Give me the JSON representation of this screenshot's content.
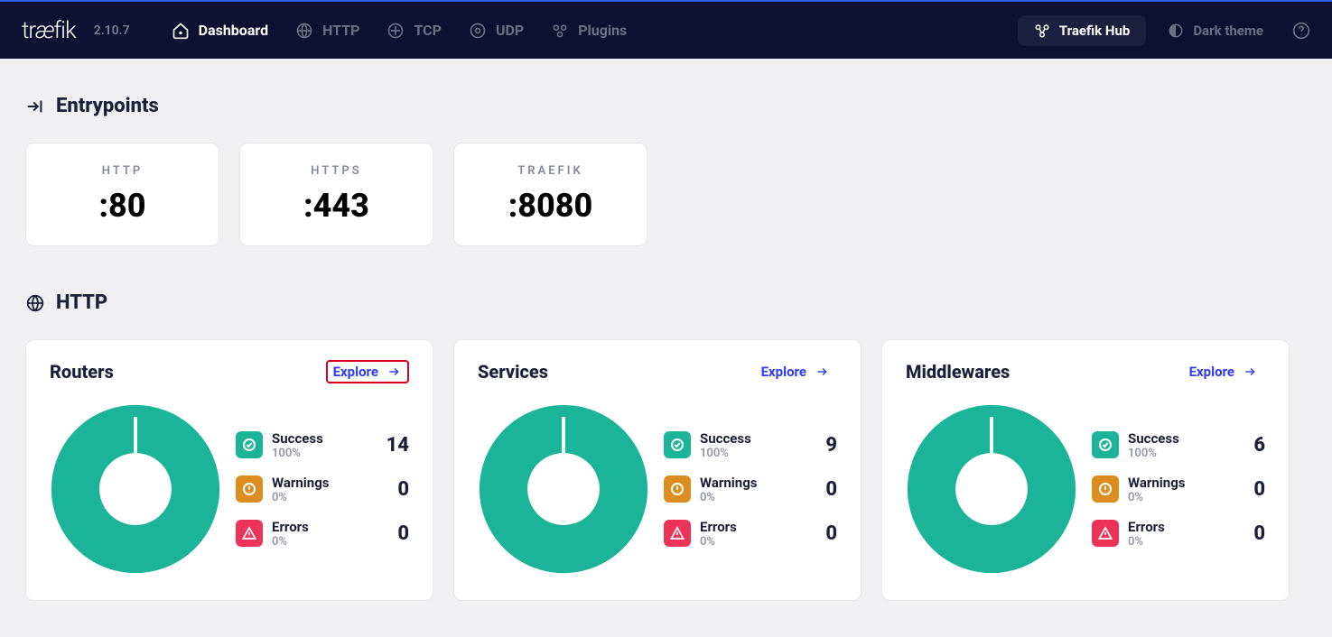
{
  "header": {
    "logo": "træfik",
    "version": "2.10.7",
    "nav": {
      "dashboard": "Dashboard",
      "http": "HTTP",
      "tcp": "TCP",
      "udp": "UDP",
      "plugins": "Plugins"
    },
    "hub": "Traefik Hub",
    "dark_theme": "Dark theme"
  },
  "sections": {
    "entrypoints": {
      "title": "Entrypoints"
    },
    "http": {
      "title": "HTTP"
    }
  },
  "entrypoints": [
    {
      "name": "HTTP",
      "port": ":80"
    },
    {
      "name": "HTTPS",
      "port": ":443"
    },
    {
      "name": "TRAEFIK",
      "port": ":8080"
    }
  ],
  "panels": {
    "routers": {
      "title": "Routers",
      "explore": "Explore",
      "success": {
        "label": "Success",
        "pct": "100%",
        "count": "14"
      },
      "warnings": {
        "label": "Warnings",
        "pct": "0%",
        "count": "0"
      },
      "errors": {
        "label": "Errors",
        "pct": "0%",
        "count": "0"
      }
    },
    "services": {
      "title": "Services",
      "explore": "Explore",
      "success": {
        "label": "Success",
        "pct": "100%",
        "count": "9"
      },
      "warnings": {
        "label": "Warnings",
        "pct": "0%",
        "count": "0"
      },
      "errors": {
        "label": "Errors",
        "pct": "0%",
        "count": "0"
      }
    },
    "middlewares": {
      "title": "Middlewares",
      "explore": "Explore",
      "success": {
        "label": "Success",
        "pct": "100%",
        "count": "6"
      },
      "warnings": {
        "label": "Warnings",
        "pct": "0%",
        "count": "0"
      },
      "errors": {
        "label": "Errors",
        "pct": "0%",
        "count": "0"
      }
    }
  },
  "colors": {
    "success": "#1bb499",
    "warn": "#dd8d1f",
    "err": "#ee335a",
    "accent": "#2f3bf0"
  },
  "chart_data": [
    {
      "type": "pie",
      "title": "Routers",
      "categories": [
        "Success",
        "Warnings",
        "Errors"
      ],
      "values": [
        14,
        0,
        0
      ],
      "series_colors": [
        "#1bb499",
        "#dd8d1f",
        "#ee335a"
      ]
    },
    {
      "type": "pie",
      "title": "Services",
      "categories": [
        "Success",
        "Warnings",
        "Errors"
      ],
      "values": [
        9,
        0,
        0
      ],
      "series_colors": [
        "#1bb499",
        "#dd8d1f",
        "#ee335a"
      ]
    },
    {
      "type": "pie",
      "title": "Middlewares",
      "categories": [
        "Success",
        "Warnings",
        "Errors"
      ],
      "values": [
        6,
        0,
        0
      ],
      "series_colors": [
        "#1bb499",
        "#dd8d1f",
        "#ee335a"
      ]
    }
  ]
}
